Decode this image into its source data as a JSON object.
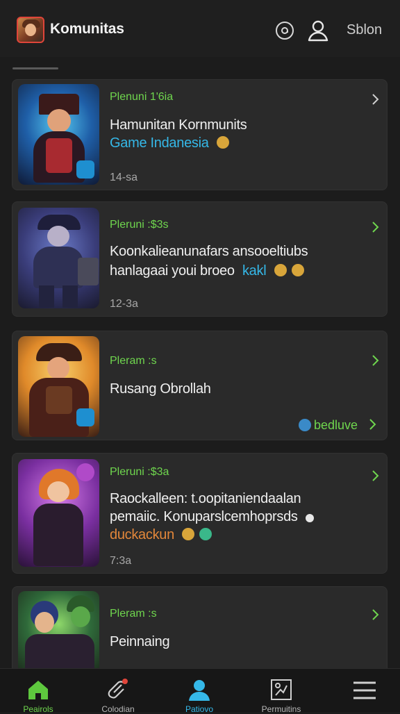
{
  "header": {
    "title": "Komunitas",
    "action_label": "Sblon",
    "logo_icon": "avatar-icon",
    "icons": [
      "notification-icon",
      "profile-icon"
    ]
  },
  "posts": [
    {
      "meta": "Plenuni 1'6ia",
      "title_lines": [
        "Hamunitan Kornmunits",
        "Game Indanesia"
      ],
      "time": "14-sa",
      "thumb_colors": [
        "#1f5fa8",
        "#3ab7e8",
        "#1a1a2a"
      ]
    },
    {
      "meta": "Pleruni :$3s",
      "title_lines": [
        "Koonkalieanunafars ansooeltiubs",
        "hanlagaai youi broeo"
      ],
      "title_accent": "kakl",
      "time": "12-3a",
      "thumb_colors": [
        "#3a3d7a",
        "#5a6ab8",
        "#22223a"
      ]
    },
    {
      "meta": "Pleram :s",
      "title_lines": [
        "Rusang Obrollah"
      ],
      "tag": "bedluve",
      "thumb_colors": [
        "#e08a2a",
        "#f3c15a",
        "#3a1e14"
      ]
    },
    {
      "meta": "Pleruni :$3a",
      "title_lines": [
        "Raockalleen: t.oopitaniendaalan",
        "pemaiic. Konuparslcemhoprsds"
      ],
      "title_accent": "duckackun",
      "time": "7:3a",
      "thumb_colors": [
        "#7a2fa0",
        "#c45ad8",
        "#2a1238"
      ]
    },
    {
      "meta": "Pleram :s",
      "title_lines": [
        "Peinnaing"
      ],
      "thumb_colors": [
        "#2f6a3a",
        "#6fbf5a",
        "#1c2a1c"
      ]
    }
  ],
  "bottom_nav": [
    {
      "label": "Peairols",
      "icon": "home-icon",
      "color": "#5ec83e"
    },
    {
      "label": "Colodian",
      "icon": "pin-icon",
      "color": "#cfcfcf"
    },
    {
      "label": "Patiovo",
      "icon": "user-icon",
      "color": "#35b8e8"
    },
    {
      "label": "Permuitins",
      "icon": "puzzle-icon",
      "color": "#cfcfcf"
    },
    {
      "label": "",
      "icon": "menu-icon",
      "color": "#cfcfcf"
    }
  ]
}
